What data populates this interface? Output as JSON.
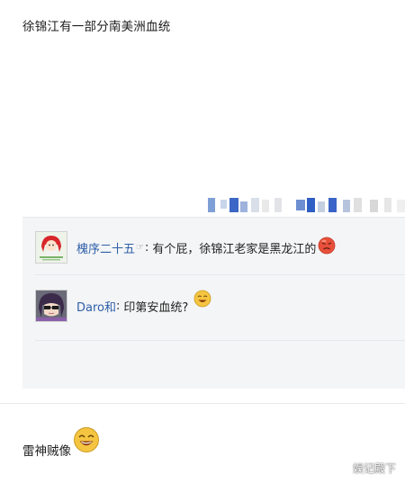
{
  "post": {
    "text": "徐锦江有一部分南美洲血统"
  },
  "comments": [
    {
      "user": "槐序二十五",
      "hand_icon": "☞",
      "separator": ":",
      "text": "有个屁，徐锦江老家是黑龙江的",
      "emoji": "angry-face-emoji"
    },
    {
      "user": "Daro和",
      "separator": ":",
      "text": "印第安血统?",
      "emoji": "grin-face-emoji"
    }
  ],
  "footer": {
    "text": "雷神贼像",
    "emoji": "big-smile-emoji"
  },
  "watermark": "娱记殿下",
  "colors": {
    "username": "#2e5fa8",
    "comment_bg": "#f4f5f7",
    "emoji_yellow": "#f5c542",
    "emoji_red": "#e8503a"
  }
}
